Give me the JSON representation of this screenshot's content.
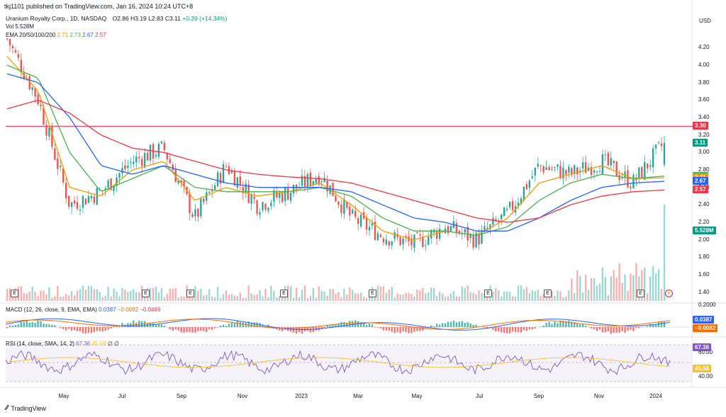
{
  "header": {
    "text": "tkj1101 published on TradingView.com, Jan 16, 2024 10:24 UTC+8"
  },
  "legend": {
    "symbol": "Uranium Royalty Corp., 1D, NASDAQ",
    "o": "O2.86",
    "h": "H3.19",
    "l": "L2.83",
    "c": "C3.11",
    "chg": "+0.39 (+14.34%)",
    "vol_label": "Vol",
    "vol_value": "5.528M",
    "ema_label": "EMA 20/50/100/200",
    "ema_values": [
      "2.71",
      "2.73",
      "2.67",
      "2.57"
    ]
  },
  "macd_legend": {
    "label": "MACD (12, 26, close, 9, EMA, EMA)",
    "values": [
      "0.0387",
      "−0.0082",
      "−0.0469"
    ]
  },
  "rsi_legend": {
    "label": "RSI (14, close, SMA, 14, 2)",
    "values": [
      "67.36",
      "45.58",
      "∅",
      "∅"
    ]
  },
  "currency": "USD",
  "price_ticks": [
    "4.20",
    "4.00",
    "3.80",
    "3.60",
    "3.40",
    "3.20",
    "3.00",
    "2.80",
    "2.60",
    "2.40",
    "2.20",
    "2.00",
    "1.80",
    "1.60",
    "1.40"
  ],
  "price_badges": [
    {
      "text": "3.30",
      "color": "#f23645",
      "price": 3.3
    },
    {
      "text": "3.11",
      "color": "#089981",
      "price": 3.11
    },
    {
      "text": "2.73",
      "color": "#4caf50",
      "price": 2.73
    },
    {
      "text": "2.71",
      "color": "#ff9800",
      "price": 2.71
    },
    {
      "text": "2.67",
      "color": "#2962ff",
      "price": 2.67
    },
    {
      "text": "2.57",
      "color": "#f23645",
      "price": 2.57
    },
    {
      "text": "5.528M",
      "color": "#089981",
      "price": 2.1
    }
  ],
  "macd_ticks": [
    "0.2000"
  ],
  "macd_badges": [
    {
      "text": "0.0387",
      "color": "#2962ff"
    },
    {
      "text": "−0.0082",
      "color": "#ff6d00"
    }
  ],
  "rsi_ticks": [
    "60.00",
    "40.00"
  ],
  "rsi_badges": [
    {
      "text": "67.36",
      "color": "#7e57c2"
    },
    {
      "text": "45.58",
      "color": "#fbc02d"
    }
  ],
  "time_ticks": [
    "May",
    "Jul",
    "Sep",
    "Nov",
    "2023",
    "Mar",
    "May",
    "Jul",
    "Sep",
    "Nov",
    "2024"
  ],
  "event_marker": "E",
  "logo_text": "TradingView",
  "colors": {
    "up": "#26a69a",
    "down": "#ef5350",
    "ema20": "#ff9800",
    "ema50": "#4caf50",
    "ema100": "#2962ff",
    "ema200": "#f23645",
    "resistance": "#f23645",
    "rsi_line": "#7e57c2",
    "rsi_ma": "#fbc02d"
  },
  "chart_data": {
    "type": "line",
    "title": "Uranium Royalty Corp., 1D, NASDAQ",
    "xlabel": "",
    "ylabel": "USD",
    "ylim": [
      1.3,
      4.6
    ],
    "x": [
      "2022-04",
      "2022-05",
      "2022-06",
      "2022-07",
      "2022-08",
      "2022-09",
      "2022-10",
      "2022-11",
      "2022-12",
      "2023-01",
      "2023-02",
      "2023-03",
      "2023-04",
      "2023-05",
      "2023-06",
      "2023-07",
      "2023-08",
      "2023-09",
      "2023-10",
      "2023-11",
      "2023-12",
      "2024-01"
    ],
    "resistance_level": 3.3,
    "series": [
      {
        "name": "Close",
        "values": [
          4.3,
          3.6,
          2.4,
          2.55,
          2.9,
          3.05,
          2.25,
          2.85,
          2.4,
          2.55,
          2.75,
          2.25,
          2.05,
          1.95,
          2.15,
          2.0,
          2.3,
          2.85,
          2.75,
          2.9,
          2.65,
          3.11
        ]
      },
      {
        "name": "EMA 20",
        "values": [
          4.1,
          3.7,
          2.6,
          2.5,
          2.8,
          2.9,
          2.45,
          2.6,
          2.5,
          2.55,
          2.65,
          2.4,
          2.1,
          2.0,
          2.1,
          2.05,
          2.25,
          2.65,
          2.75,
          2.85,
          2.7,
          2.71
        ]
      },
      {
        "name": "EMA 50",
        "values": [
          4.0,
          3.85,
          3.0,
          2.55,
          2.7,
          2.85,
          2.6,
          2.55,
          2.55,
          2.55,
          2.6,
          2.5,
          2.25,
          2.1,
          2.1,
          2.05,
          2.15,
          2.45,
          2.65,
          2.75,
          2.7,
          2.73
        ]
      },
      {
        "name": "EMA 100",
        "values": [
          3.9,
          3.8,
          3.4,
          2.85,
          2.75,
          2.85,
          2.75,
          2.65,
          2.6,
          2.6,
          2.6,
          2.55,
          2.4,
          2.25,
          2.2,
          2.1,
          2.1,
          2.25,
          2.45,
          2.6,
          2.65,
          2.67
        ]
      },
      {
        "name": "EMA 200",
        "values": [
          3.5,
          3.6,
          3.45,
          3.2,
          3.05,
          3.0,
          2.9,
          2.8,
          2.75,
          2.72,
          2.7,
          2.65,
          2.55,
          2.45,
          2.35,
          2.25,
          2.2,
          2.25,
          2.4,
          2.5,
          2.55,
          2.57
        ]
      }
    ]
  }
}
